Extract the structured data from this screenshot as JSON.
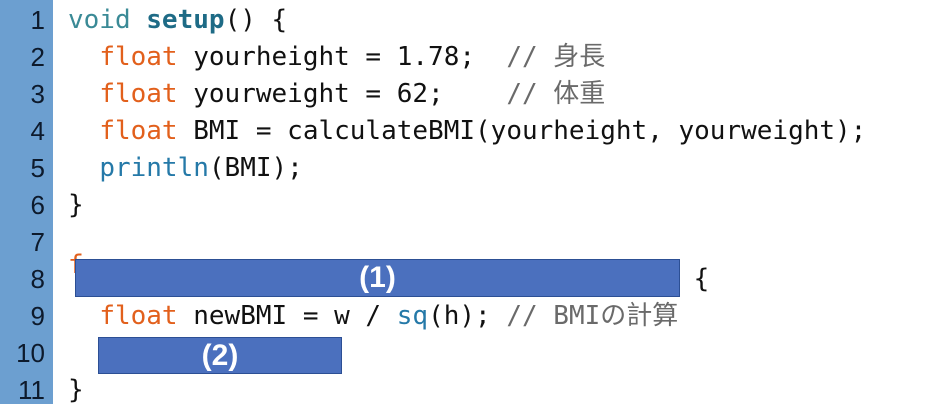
{
  "line_numbers": [
    "1",
    "2",
    "3",
    "4",
    "5",
    "6",
    "7",
    "8",
    "9",
    "10",
    "11"
  ],
  "lines": {
    "l1": {
      "void": "void",
      "setup": "setup",
      "rest": "() {"
    },
    "l2": {
      "indent": "  ",
      "float": "float",
      "code": " yourheight = 1.78;  ",
      "comment": "// 身長"
    },
    "l3": {
      "indent": "  ",
      "float": "float",
      "code": " yourweight = 62;    ",
      "comment": "// 体重"
    },
    "l4": {
      "indent": "  ",
      "float": "float",
      "code": " BMI = calculateBMI(yourheight, yourweight);"
    },
    "l5": {
      "indent": "  ",
      "fn": "println",
      "code": "(BMI);"
    },
    "l6": {
      "code": "}"
    },
    "l8": {
      "partial": "f",
      "brace": " {"
    },
    "l9": {
      "indent": "  ",
      "float": "float",
      "code1": " newBMI = w / ",
      "fn": "sq",
      "code2": "(h); ",
      "comment": "// BMIの計算"
    },
    "l11": {
      "code": "}"
    }
  },
  "blanks": {
    "b1": "(1)",
    "b2": "(2)"
  },
  "colors": {
    "gutter": "#6c9fd0",
    "blank": "#4b70be",
    "keyword_float": "#e2601c",
    "keyword_fn": "#2579a8",
    "comment": "#6a6a6a"
  }
}
